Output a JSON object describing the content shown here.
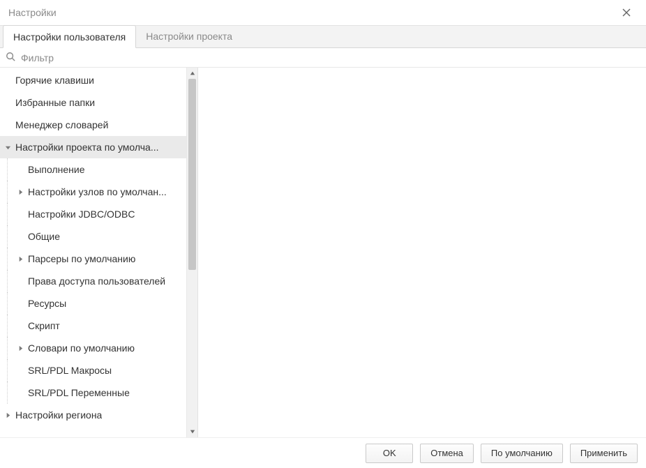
{
  "window": {
    "title": "Настройки"
  },
  "tabs": {
    "user": "Настройки пользователя",
    "project": "Настройки проекта"
  },
  "filter": {
    "placeholder": "Фильтр"
  },
  "tree": {
    "hotkeys": "Горячие клавиши",
    "favorites": "Избранные папки",
    "dictmgr": "Менеджер словарей",
    "default_project": "Настройки проекта по умолча...",
    "execution": "Выполнение",
    "default_nodes": "Настройки узлов по умолчан...",
    "jdbc": "Настройки JDBC/ODBC",
    "general": "Общие",
    "parsers": "Парсеры по умолчанию",
    "access": "Права доступа пользователей",
    "resources": "Ресурсы",
    "script": "Скрипт",
    "dicts": "Словари по умолчанию",
    "srl_macros": "SRL/PDL Макросы",
    "srl_vars": "SRL/PDL Переменные",
    "region": "Настройки региона"
  },
  "buttons": {
    "ok": "OK",
    "cancel": "Отмена",
    "default": "По умолчанию",
    "apply": "Применить"
  }
}
